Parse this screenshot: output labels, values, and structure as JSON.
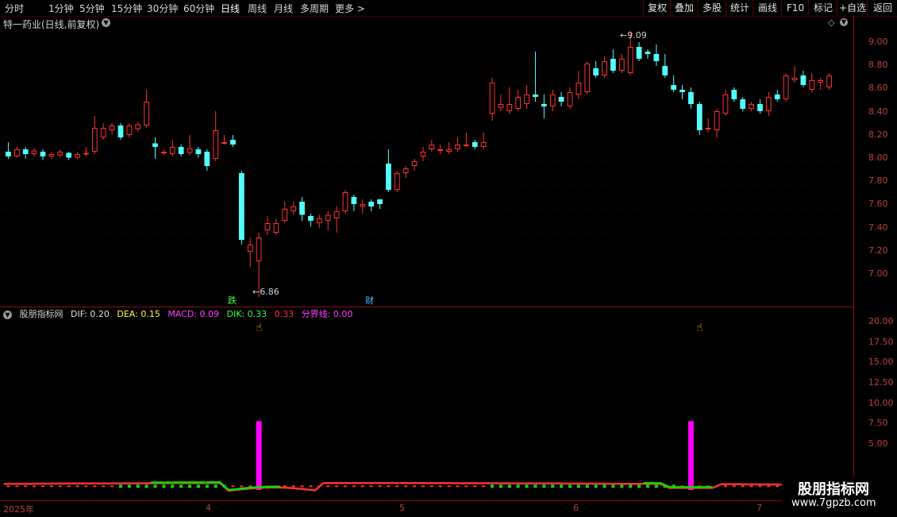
{
  "toolbar": {
    "periods": [
      "分时",
      "1分钟",
      "5分钟",
      "15分钟",
      "30分钟",
      "60分钟",
      "日线",
      "周线",
      "月线",
      "多周期",
      "更多 >"
    ],
    "active_period": "日线",
    "right_buttons": [
      "复权",
      "叠加",
      "多股",
      "统计",
      "画线",
      "F10",
      "标记",
      "+自选",
      "返回"
    ]
  },
  "price_panel": {
    "title": "特一药业(日线,前复权)",
    "high_label": "9.09",
    "low_label": "6.86",
    "badge_die": "跌",
    "badge_cai": "财"
  },
  "price_axis": [
    "9.00",
    "8.80",
    "8.60",
    "8.40",
    "8.20",
    "8.00",
    "7.80",
    "7.60",
    "7.40",
    "7.20",
    "7.00"
  ],
  "indicator": {
    "name": "股朋指标网",
    "dif": "DIF: 0.20",
    "dea": "DEA: 0.15",
    "macd": "MACD: 0.09",
    "dik": "DIK: 0.33",
    "extra": "0.33",
    "boundary": "分界线: 0.00"
  },
  "indicator_axis": [
    "20.00",
    "17.50",
    "15.00",
    "12.50",
    "10.00",
    "7.50",
    "5.00"
  ],
  "date_axis": [
    "2025年",
    "4",
    "5",
    "6",
    "7"
  ],
  "watermark": {
    "title": "股朋指标网",
    "url": "www.7gpzb.com"
  },
  "colors": {
    "up": "#ff3232",
    "down": "#54ffff",
    "magenta": "#ff00ff",
    "green": "#00e000",
    "axis": "#8a1010"
  },
  "chart_data": {
    "type": "candlestick",
    "price_range": [
      6.78,
      9.22
    ],
    "candles": [
      [
        8.08,
        8.04,
        8.16,
        8.02
      ],
      [
        8.04,
        8.1,
        8.12,
        8.03
      ],
      [
        8.1,
        8.06,
        8.12,
        8.02
      ],
      [
        8.06,
        8.09,
        8.11,
        8.04
      ],
      [
        8.08,
        8.04,
        8.1,
        8.01
      ],
      [
        8.04,
        8.06,
        8.08,
        8.02
      ],
      [
        8.05,
        8.08,
        8.1,
        8.03
      ],
      [
        8.07,
        8.03,
        8.08,
        8.01
      ],
      [
        8.03,
        8.06,
        8.08,
        8.02
      ],
      [
        8.06,
        8.07,
        8.12,
        8.04
      ],
      [
        8.08,
        8.28,
        8.38,
        8.06
      ],
      [
        8.2,
        8.28,
        8.32,
        8.18
      ],
      [
        8.26,
        8.3,
        8.32,
        8.22
      ],
      [
        8.3,
        8.2,
        8.32,
        8.18
      ],
      [
        8.22,
        8.3,
        8.32,
        8.2
      ],
      [
        8.27,
        8.31,
        8.33,
        8.25
      ],
      [
        8.3,
        8.5,
        8.6,
        8.28
      ],
      [
        8.15,
        8.12,
        8.2,
        8.02
      ],
      [
        8.08,
        8.08,
        8.1,
        8.05
      ],
      [
        8.06,
        8.12,
        8.18,
        8.04
      ],
      [
        8.12,
        8.06,
        8.14,
        8.04
      ],
      [
        8.07,
        8.11,
        8.22,
        8.05
      ],
      [
        8.1,
        8.06,
        8.12,
        8.03
      ],
      [
        8.08,
        7.96,
        8.1,
        7.92
      ],
      [
        8.02,
        8.26,
        8.42,
        8.0
      ],
      [
        8.16,
        8.16,
        8.22,
        8.14
      ],
      [
        8.18,
        8.14,
        8.22,
        8.12
      ],
      [
        7.9,
        7.34,
        7.92,
        7.3
      ],
      [
        7.24,
        7.3,
        7.36,
        7.11
      ],
      [
        7.16,
        7.36,
        7.4,
        6.86
      ],
      [
        7.42,
        7.48,
        7.54,
        7.38
      ],
      [
        7.4,
        7.48,
        7.52,
        7.38
      ],
      [
        7.5,
        7.6,
        7.66,
        7.48
      ],
      [
        7.58,
        7.62,
        7.66,
        7.55
      ],
      [
        7.66,
        7.55,
        7.7,
        7.5
      ],
      [
        7.54,
        7.5,
        7.56,
        7.45
      ],
      [
        7.48,
        7.52,
        7.55,
        7.44
      ],
      [
        7.5,
        7.55,
        7.58,
        7.42
      ],
      [
        7.52,
        7.58,
        7.62,
        7.4
      ],
      [
        7.58,
        7.74,
        7.76,
        7.56
      ],
      [
        7.7,
        7.64,
        7.72,
        7.58
      ],
      [
        7.62,
        7.64,
        7.68,
        7.56
      ],
      [
        7.66,
        7.62,
        7.68,
        7.58
      ],
      [
        7.68,
        7.64,
        7.68,
        7.6
      ],
      [
        7.98,
        7.76,
        8.1,
        7.74
      ],
      [
        7.76,
        7.9,
        7.92,
        7.74
      ],
      [
        7.9,
        7.94,
        7.96,
        7.86
      ],
      [
        7.96,
        8.0,
        8.02,
        7.92
      ],
      [
        8.04,
        8.08,
        8.12,
        8.0
      ],
      [
        8.1,
        8.14,
        8.18,
        8.08
      ],
      [
        8.1,
        8.1,
        8.14,
        8.06
      ],
      [
        8.08,
        8.1,
        8.16,
        8.06
      ],
      [
        8.1,
        8.14,
        8.2,
        8.08
      ],
      [
        8.14,
        8.14,
        8.24,
        8.12
      ],
      [
        8.16,
        8.12,
        8.18,
        8.1
      ],
      [
        8.12,
        8.16,
        8.24,
        8.1
      ],
      [
        8.4,
        8.66,
        8.7,
        8.34
      ],
      [
        8.45,
        8.48,
        8.56,
        8.42
      ],
      [
        8.42,
        8.48,
        8.62,
        8.4
      ],
      [
        8.44,
        8.54,
        8.6,
        8.42
      ],
      [
        8.48,
        8.56,
        8.64,
        8.44
      ],
      [
        8.56,
        8.54,
        8.92,
        8.5
      ],
      [
        8.48,
        8.46,
        8.56,
        8.36
      ],
      [
        8.46,
        8.56,
        8.6,
        8.42
      ],
      [
        8.54,
        8.5,
        8.58,
        8.46
      ],
      [
        8.46,
        8.58,
        8.62,
        8.44
      ],
      [
        8.56,
        8.66,
        8.76,
        8.52
      ],
      [
        8.58,
        8.82,
        8.84,
        8.56
      ],
      [
        8.78,
        8.72,
        8.84,
        8.7
      ],
      [
        8.72,
        8.84,
        8.88,
        8.7
      ],
      [
        8.86,
        8.76,
        8.94,
        8.74
      ],
      [
        8.76,
        8.86,
        8.9,
        8.74
      ],
      [
        8.74,
        8.96,
        9.09,
        8.72
      ],
      [
        8.96,
        8.86,
        9.0,
        8.84
      ],
      [
        8.92,
        8.9,
        8.94,
        8.86
      ],
      [
        8.9,
        8.84,
        8.98,
        8.8
      ],
      [
        8.8,
        8.72,
        8.9,
        8.7
      ],
      [
        8.64,
        8.6,
        8.72,
        8.58
      ],
      [
        8.6,
        8.58,
        8.64,
        8.52
      ],
      [
        8.58,
        8.48,
        8.62,
        8.44
      ],
      [
        8.48,
        8.26,
        8.5,
        8.22
      ],
      [
        8.28,
        8.28,
        8.36,
        8.24
      ],
      [
        8.26,
        8.42,
        8.44,
        8.2
      ],
      [
        8.4,
        8.56,
        8.6,
        8.38
      ],
      [
        8.6,
        8.52,
        8.62,
        8.5
      ],
      [
        8.52,
        8.44,
        8.54,
        8.42
      ],
      [
        8.44,
        8.48,
        8.5,
        8.42
      ],
      [
        8.48,
        8.42,
        8.52,
        8.4
      ],
      [
        8.42,
        8.54,
        8.58,
        8.38
      ],
      [
        8.56,
        8.52,
        8.6,
        8.5
      ],
      [
        8.52,
        8.72,
        8.74,
        8.5
      ],
      [
        8.68,
        8.7,
        8.8,
        8.66
      ],
      [
        8.72,
        8.64,
        8.76,
        8.62
      ],
      [
        8.6,
        8.68,
        8.74,
        8.58
      ],
      [
        8.66,
        8.68,
        8.7,
        8.6
      ],
      [
        8.62,
        8.72,
        8.74,
        8.6
      ]
    ],
    "macd_signal_bars": [
      {
        "index": 29,
        "value": 8.2
      },
      {
        "index": 79,
        "value": 8.2
      }
    ],
    "indicator_range": [
      0,
      21
    ]
  }
}
